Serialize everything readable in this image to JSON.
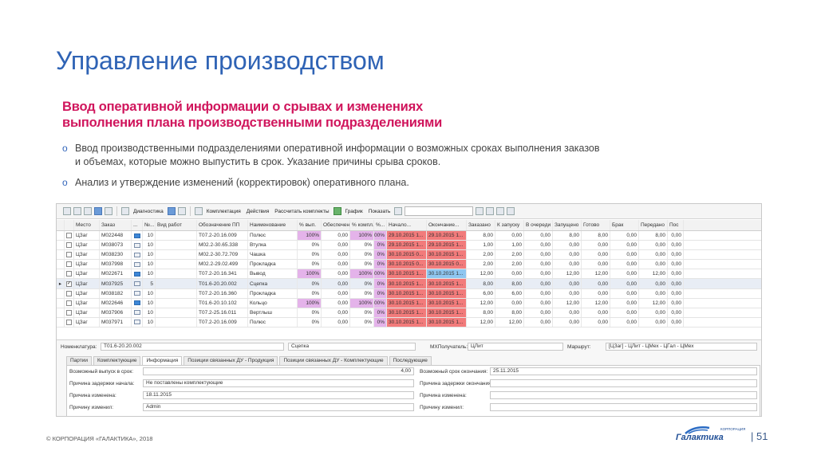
{
  "title": "Управление производством",
  "subtitle_line1": "Ввод оперативной информации о срывах и изменениях",
  "subtitle_line2": "выполнения плана производственными подразделениями",
  "bullets": [
    "Ввод производственными подразделениями оперативной информации о возможных сроках выполнения заказов и объемах, которые можно выпустить в срок. Указание причины срыва сроков.",
    "Анализ и утверждение изменений (корректировок) оперативного плана."
  ],
  "toolbar": {
    "diagnostics": "Диагностика",
    "komplektaciya": "Комплектация",
    "actions": "Действия",
    "recalc": "Рассчитать комплекты",
    "graph": "График",
    "show": "Показать"
  },
  "columns": [
    "",
    "",
    "Место",
    "Заказ",
    "...",
    "№...",
    "Вид работ",
    "Обозначение ПП",
    "Наименование",
    "% вып.",
    "Обеспечено",
    "% компл.",
    "%...",
    "Начало...",
    "Окончание...",
    "Заказано",
    "К запуску",
    "В очереди",
    "Запущено",
    "Готово",
    "Брак",
    "Передано",
    "Пос"
  ],
  "rows": [
    {
      "mesto": "ЦЗаг",
      "zakaz": "М022448",
      "flag": true,
      "num": "10",
      "oboz": "Т07.2-20.16.009",
      "name": "Полюс",
      "vyp": "100%",
      "obesp": "0,00",
      "kompl": "100%",
      "p": "100%",
      "start": "29.10.2015 1...",
      "end": "29.10.2015 1...",
      "endc": "red",
      "zakazano": "8,00",
      "kzap": "0,00",
      "och": "0,00",
      "zap": "8,00",
      "gotovo": "8,00",
      "brak": "0,00",
      "pered": "8,00",
      "pos": "0,00",
      "sel": false,
      "checked": false
    },
    {
      "mesto": "ЦЗаг",
      "zakaz": "М038073",
      "flag": false,
      "num": "10",
      "oboz": "М02.2-30.65.338",
      "name": "Втулка",
      "vyp": "0%",
      "obesp": "0,00",
      "kompl": "0%",
      "p": "0%",
      "start": "29.10.2015 1...",
      "end": "29.10.2015 1...",
      "endc": "red",
      "zakazano": "1,00",
      "kzap": "1,00",
      "och": "0,00",
      "zap": "0,00",
      "gotovo": "0,00",
      "brak": "0,00",
      "pered": "0,00",
      "pos": "0,00",
      "sel": false,
      "checked": false
    },
    {
      "mesto": "ЦЗаг",
      "zakaz": "М038230",
      "flag": false,
      "num": "10",
      "oboz": "М02.2-30.72.709",
      "name": "Чашка",
      "vyp": "0%",
      "obesp": "0,00",
      "kompl": "0%",
      "p": "0%",
      "start": "30.10.2015 0...",
      "end": "30.10.2015 1...",
      "endc": "red",
      "zakazano": "2,00",
      "kzap": "2,00",
      "och": "0,00",
      "zap": "0,00",
      "gotovo": "0,00",
      "brak": "0,00",
      "pered": "0,00",
      "pos": "0,00",
      "sel": false,
      "checked": false
    },
    {
      "mesto": "ЦЗаг",
      "zakaz": "М037998",
      "flag": false,
      "num": "10",
      "oboz": "М02.2-29.02.499",
      "name": "Прокладка",
      "vyp": "0%",
      "obesp": "0,00",
      "kompl": "0%",
      "p": "0%",
      "start": "30.10.2015 0...",
      "end": "30.10.2015 0...",
      "endc": "red",
      "zakazano": "2,00",
      "kzap": "2,00",
      "och": "0,00",
      "zap": "0,00",
      "gotovo": "0,00",
      "brak": "0,00",
      "pered": "0,00",
      "pos": "0,00",
      "sel": false,
      "checked": false
    },
    {
      "mesto": "ЦЗаг",
      "zakaz": "М022671",
      "flag": true,
      "num": "10",
      "oboz": "Т07.2-20.16.341",
      "name": "Вывод",
      "vyp": "100%",
      "obesp": "0,00",
      "kompl": "100%",
      "p": "100%",
      "start": "30.10.2015 1...",
      "end": "30.10.2015 1...",
      "endc": "blue",
      "zakazano": "12,00",
      "kzap": "0,00",
      "och": "0,00",
      "zap": "12,00",
      "gotovo": "12,00",
      "brak": "0,00",
      "pered": "12,00",
      "pos": "0,00",
      "sel": false,
      "checked": false
    },
    {
      "mesto": "ЦЗаг",
      "zakaz": "М037925",
      "flag": false,
      "num": "5",
      "oboz": "Т01.6-20.20.002",
      "name": "Сцепка",
      "vyp": "0%",
      "obesp": "0,00",
      "kompl": "0%",
      "p": "0%",
      "start": "30.10.2015 1...",
      "end": "30.10.2015 1...",
      "endc": "red",
      "zakazano": "8,00",
      "kzap": "8,00",
      "och": "0,00",
      "zap": "0,00",
      "gotovo": "0,00",
      "brak": "0,00",
      "pered": "0,00",
      "pos": "0,00",
      "sel": true,
      "checked": true
    },
    {
      "mesto": "ЦЗаг",
      "zakaz": "М038182",
      "flag": false,
      "num": "10",
      "oboz": "Т07.2-20.16.360",
      "name": "Прокладка",
      "vyp": "0%",
      "obesp": "0,00",
      "kompl": "0%",
      "p": "0%",
      "start": "30.10.2015 1...",
      "end": "30.10.2015 1...",
      "endc": "red",
      "zakazano": "6,00",
      "kzap": "6,00",
      "och": "0,00",
      "zap": "0,00",
      "gotovo": "0,00",
      "brak": "0,00",
      "pered": "0,00",
      "pos": "0,00",
      "sel": false,
      "checked": false
    },
    {
      "mesto": "ЦЗаг",
      "zakaz": "М022646",
      "flag": true,
      "num": "10",
      "oboz": "Т01.6-20.10.102",
      "name": "Кольцо",
      "vyp": "100%",
      "obesp": "0,00",
      "kompl": "100%",
      "p": "100%",
      "start": "30.10.2015 1...",
      "end": "30.10.2015 1...",
      "endc": "red",
      "zakazano": "12,00",
      "kzap": "0,00",
      "och": "0,00",
      "zap": "12,00",
      "gotovo": "12,00",
      "brak": "0,00",
      "pered": "12,00",
      "pos": "0,00",
      "sel": false,
      "checked": false
    },
    {
      "mesto": "ЦЗаг",
      "zakaz": "М037906",
      "flag": false,
      "num": "10",
      "oboz": "Т07.2-25.16.011",
      "name": "Вертлыш",
      "vyp": "0%",
      "obesp": "0,00",
      "kompl": "0%",
      "p": "0%",
      "start": "30.10.2015 1...",
      "end": "30.10.2015 1...",
      "endc": "red",
      "zakazano": "8,00",
      "kzap": "8,00",
      "och": "0,00",
      "zap": "0,00",
      "gotovo": "0,00",
      "brak": "0,00",
      "pered": "0,00",
      "pos": "0,00",
      "sel": false,
      "checked": false
    },
    {
      "mesto": "ЦЗаг",
      "zakaz": "М037971",
      "flag": false,
      "num": "10",
      "oboz": "Т07.2-20.16.009",
      "name": "Полюс",
      "vyp": "0%",
      "obesp": "0,00",
      "kompl": "0%",
      "p": "0%",
      "start": "30.10.2015 1...",
      "end": "30.10.2015 1...",
      "endc": "red",
      "zakazano": "12,00",
      "kzap": "12,00",
      "och": "0,00",
      "zap": "0,00",
      "gotovo": "0,00",
      "brak": "0,00",
      "pered": "0,00",
      "pos": "0,00",
      "sel": false,
      "checked": false
    }
  ],
  "details": {
    "nomenklatura_label": "Номенклатура:",
    "nomenklatura_value": "Т01.6-20.20.002",
    "nomenklatura_name": "Сцепка",
    "mx_label": "МХПолучатель:",
    "mx_value": "ЦЛит",
    "route_label": "Маршрут:",
    "route_value": "[ЦЗаг] - ЦЛит - ЦМех - ЦГал - ЦМех",
    "tabs": [
      "Партии",
      "Комплектующие",
      "Информация",
      "Позиции связанных ДУ - Продукция",
      "Позиции связанных ДУ - Комплектующие",
      "Последующие"
    ],
    "active_tab": "Информация",
    "possible_qty_label": "Возможный выпуск в срок:",
    "possible_qty_value": "4,00",
    "possible_end_label": "Возможный срок окончания:",
    "possible_end_value": "25.11.2015",
    "delay_start_label": "Причина задержки начала:",
    "delay_start_value": "Не поставлены комплектующие",
    "delay_end_label": "Причина задержки окончания:",
    "delay_end_value": "",
    "changed_label": "Причина изменена:",
    "changed_value": "18.11.2015",
    "changed2_label": "Причина изменена:",
    "changed2_value": "",
    "changed_by_label": "Причину изменил:",
    "changed_by_value": "Admin",
    "changed_by2_label": "Причину изменил:",
    "changed_by2_value": ""
  },
  "footer": "© КОРПОРАЦИЯ «ГАЛАКТИКА», 2018",
  "logo_small": "КОРПОРАЦИЯ",
  "logo_text": "Галактика",
  "page_number": "| 51"
}
